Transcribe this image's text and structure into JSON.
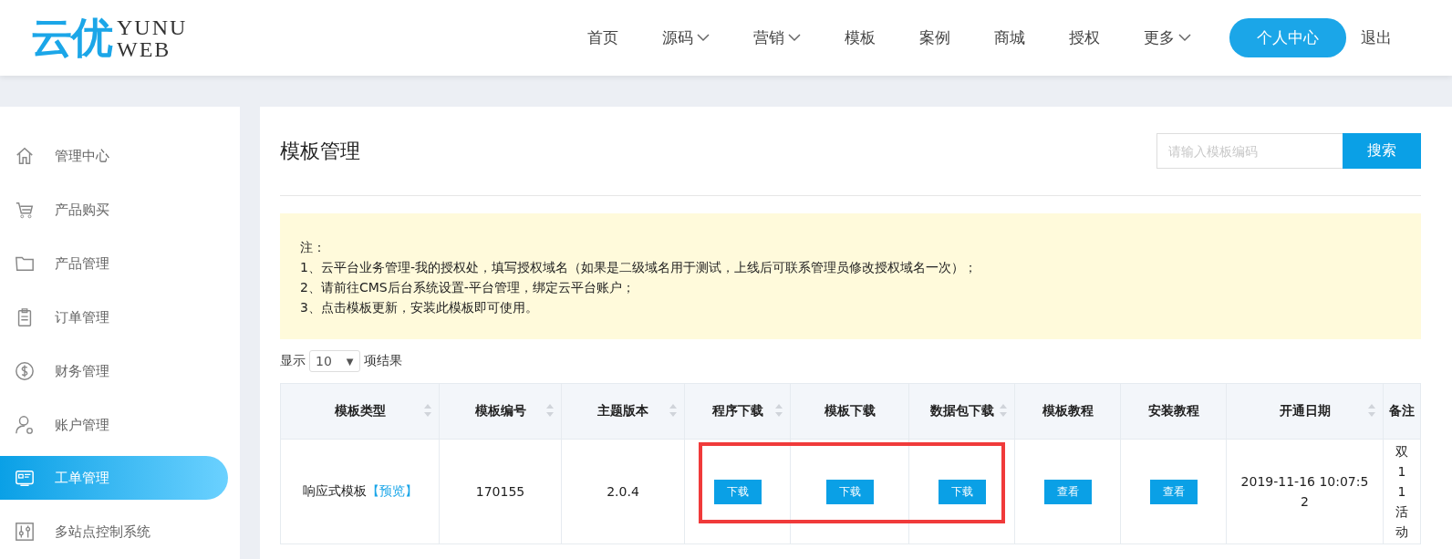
{
  "header": {
    "logo": {
      "mark": "云优",
      "word_top": "YUNU",
      "word_bottom": "WEB"
    },
    "nav": [
      {
        "label": "首页",
        "dropdown": false
      },
      {
        "label": "源码",
        "dropdown": true
      },
      {
        "label": "营销",
        "dropdown": true
      },
      {
        "label": "模板",
        "dropdown": false
      },
      {
        "label": "案例",
        "dropdown": false
      },
      {
        "label": "商城",
        "dropdown": false
      },
      {
        "label": "授权",
        "dropdown": false
      },
      {
        "label": "更多",
        "dropdown": true
      }
    ],
    "user_button": "个人中心",
    "logout": "退出"
  },
  "sidebar": {
    "items": [
      {
        "label": "管理中心",
        "kind": "home",
        "selected": false
      },
      {
        "label": "产品购买",
        "kind": "cart",
        "selected": false
      },
      {
        "label": "产品管理",
        "kind": "folder",
        "selected": false
      },
      {
        "label": "订单管理",
        "kind": "clipboard",
        "selected": false
      },
      {
        "label": "财务管理",
        "kind": "dollar",
        "selected": false
      },
      {
        "label": "账户管理",
        "kind": "user",
        "selected": false
      },
      {
        "label": "工单管理",
        "kind": "ticket",
        "selected": true
      },
      {
        "label": "多站点控制系统",
        "kind": "sliders",
        "selected": false
      }
    ]
  },
  "main": {
    "title": "模板管理",
    "search": {
      "placeholder": "请输入模板编码",
      "button": "搜索"
    },
    "notice": [
      "注：",
      "1、云平台业务管理-我的授权处，填写授权域名（如果是二级域名用于测试，上线后可联系管理员修改授权域名一次）；",
      "2、请前往CMS后台系统设置-平台管理，绑定云平台账户；",
      "3、点击模板更新，安装此模板即可使用。"
    ],
    "page_size": {
      "before": "显示",
      "value": "10",
      "arrow": "▼",
      "after": "项结果"
    },
    "table": {
      "columns": [
        {
          "label": "模板类型",
          "sortable": true
        },
        {
          "label": "模板编号",
          "sortable": true
        },
        {
          "label": "主题版本",
          "sortable": true
        },
        {
          "label": "程序下载",
          "sortable": true
        },
        {
          "label": "模板下载",
          "sortable": false
        },
        {
          "label": "数据包下载",
          "sortable": true
        },
        {
          "label": "模板教程",
          "sortable": false
        },
        {
          "label": "安装教程",
          "sortable": false
        },
        {
          "label": "开通日期",
          "sortable": true
        },
        {
          "label": "备注",
          "sortable": false
        }
      ],
      "rows": [
        {
          "cells": [
            {
              "kind": "text",
              "text": "响应式模板",
              "link": "【预览】"
            },
            {
              "kind": "text",
              "text": "170155"
            },
            {
              "kind": "text",
              "text": "2.0.4"
            },
            {
              "kind": "button",
              "text": "下载"
            },
            {
              "kind": "button",
              "text": "下载"
            },
            {
              "kind": "button",
              "text": "下载"
            },
            {
              "kind": "button",
              "text": "查看"
            },
            {
              "kind": "button",
              "text": "查看"
            },
            {
              "kind": "text",
              "text": "2019-11-16 10:07:52"
            },
            {
              "kind": "text",
              "text": "双11活动"
            }
          ]
        }
      ]
    }
  }
}
